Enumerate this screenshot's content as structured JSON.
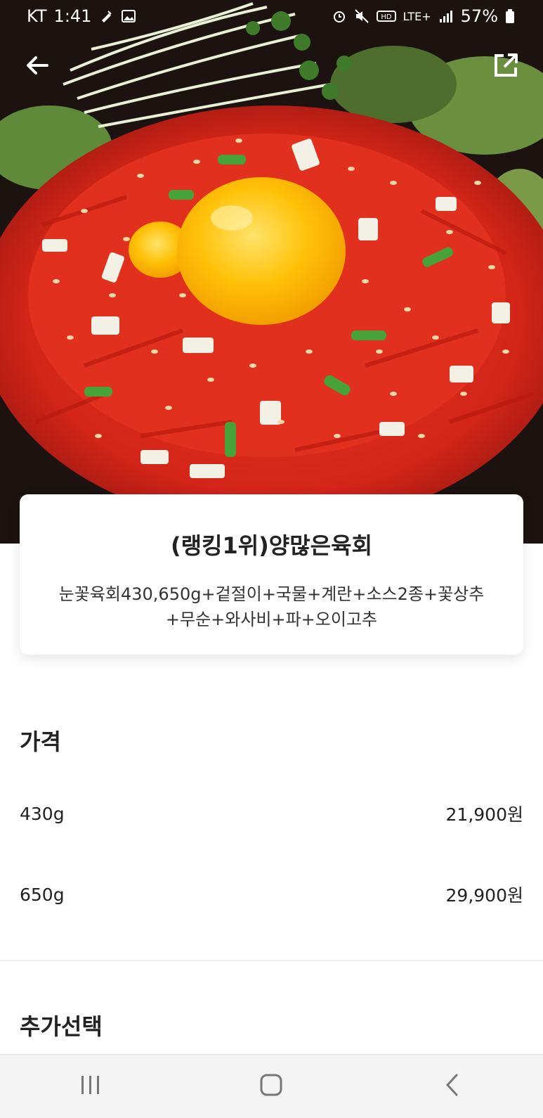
{
  "status_bar": {
    "carrier": "KT",
    "time": "1:41",
    "network": "LTE+",
    "battery": "57%",
    "icons": [
      "pin-icon",
      "image-icon",
      "alarm-icon",
      "mute-icon",
      "hd-icon",
      "signal-icon",
      "battery-icon"
    ]
  },
  "header": {
    "back_icon": "arrow-left-icon",
    "share_icon": "share-external-icon"
  },
  "product": {
    "title": "(랭킹1위)양많은육회",
    "description": "눈꽃육회430,650g+겉절이+국물+계란+소스2종+꽃상추+무순+와사비+파+오이고추"
  },
  "price_section": {
    "title": "가격",
    "options": [
      {
        "name": "430g",
        "price": "21,900원"
      },
      {
        "name": "650g",
        "price": "29,900원"
      }
    ]
  },
  "extra_section": {
    "title": "추가선택"
  },
  "nav_bar": {
    "icons": [
      "recent-apps-icon",
      "home-icon",
      "back-nav-icon"
    ]
  },
  "colors": {
    "accent_red": "#d8281e",
    "yolk": "#ffc107",
    "nav_bg": "#f4f4f4"
  }
}
